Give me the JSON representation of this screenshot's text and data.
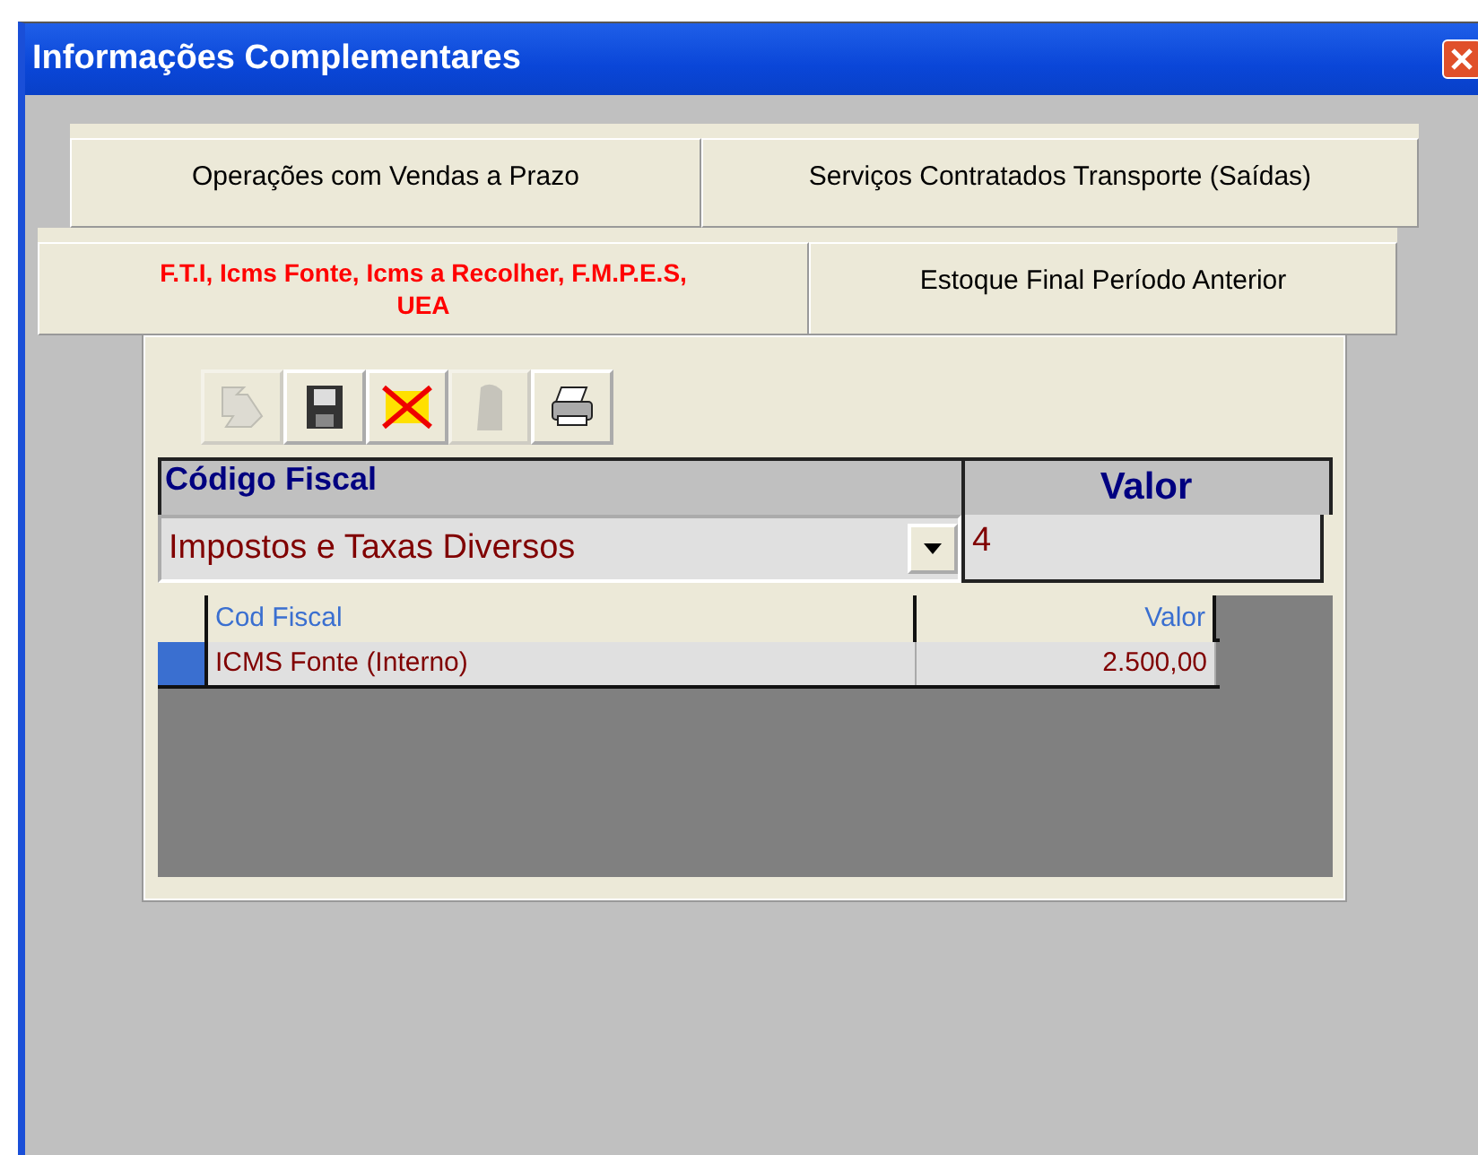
{
  "window": {
    "title": "Informações Complementares"
  },
  "tab_rows": [
    [
      {
        "label": "Operações com Vendas a Prazo",
        "selected": false
      },
      {
        "label": "Serviços Contratados Transporte (Saídas)",
        "selected": false
      }
    ],
    [
      {
        "label": "F.T.I, Icms Fonte, Icms a Recolher, F.M.P.E.S, UEA",
        "selected": true
      },
      {
        "label": "Estoque Final Período Anterior",
        "selected": false
      }
    ]
  ],
  "toolbar": [
    {
      "kind": "edit",
      "disabled": true
    },
    {
      "kind": "save",
      "disabled": false
    },
    {
      "kind": "cancel",
      "disabled": false
    },
    {
      "kind": "delete",
      "disabled": true
    },
    {
      "kind": "print",
      "disabled": false
    }
  ],
  "form": {
    "code_label": "Código Fiscal",
    "value_label": "Valor",
    "code_value": "Impostos e Taxas Diversos",
    "value_value": "4"
  },
  "grid": {
    "columns": [
      "Cod Fiscal",
      "Valor"
    ],
    "rows": [
      {
        "cells": [
          "ICMS Fonte (Interno)",
          "2.500,00"
        ],
        "selected": true
      }
    ]
  }
}
